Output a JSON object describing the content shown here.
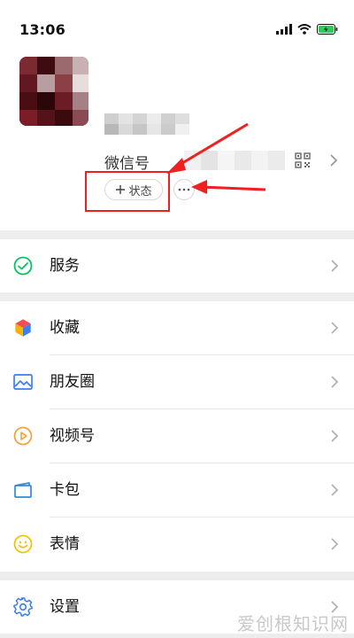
{
  "status_bar": {
    "time": "13:06",
    "icons": [
      "signal-icon",
      "wifi-icon",
      "battery-charging-icon"
    ]
  },
  "profile": {
    "wechat_id_label": "微信号",
    "status_button_label": "状态",
    "status_button_icon": "plus-icon",
    "more_button_icon": "more-icon",
    "qr_icon": "qr-code-icon"
  },
  "menu": {
    "services": "服务",
    "favorites": "收藏",
    "moments": "朋友圈",
    "channels": "视频号",
    "cards": "卡包",
    "stickers": "表情",
    "settings": "设置"
  },
  "watermark": "爱创根知识网",
  "colors": {
    "background": "#ffffff",
    "section_gap": "#ededed",
    "annotation_red": "#f02020",
    "services_green": "#07c160",
    "moments_blue": "#3c7ff0",
    "channels_orange": "#f2a13b",
    "cards_blue": "#2f8cd8",
    "stickers_yellow": "#f5c000",
    "settings_blue": "#3a7ee8"
  }
}
